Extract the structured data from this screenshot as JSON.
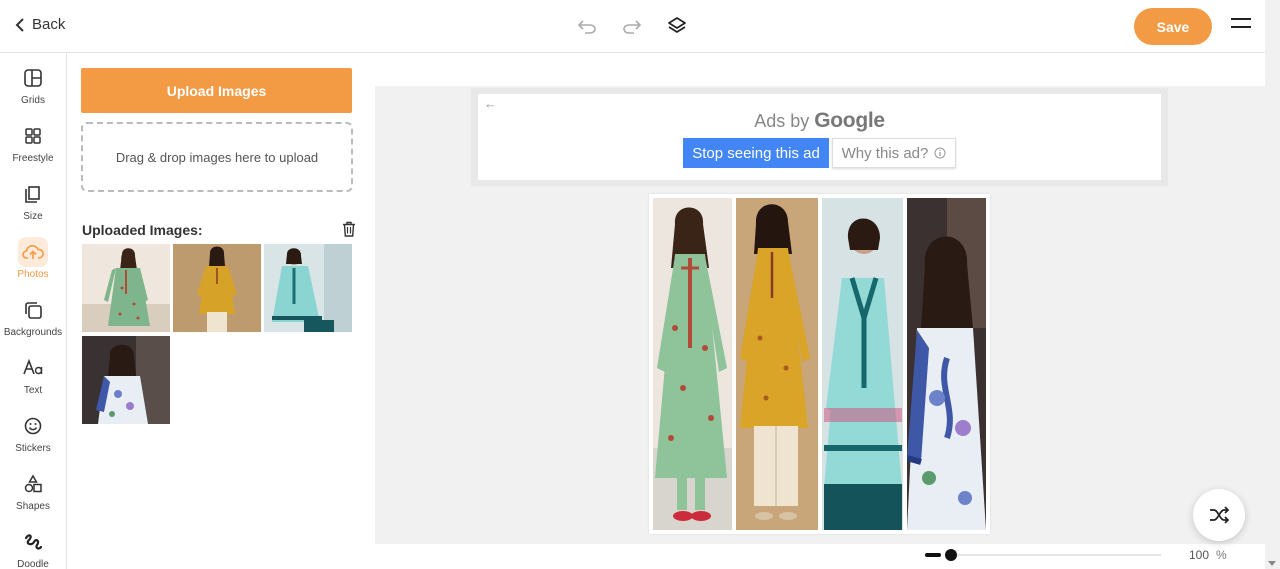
{
  "header": {
    "back_label": "Back",
    "save_label": "Save"
  },
  "rail": {
    "items": [
      {
        "label": "Grids",
        "icon": "grid-icon"
      },
      {
        "label": "Freestyle",
        "icon": "freestyle-icon"
      },
      {
        "label": "Size",
        "icon": "size-icon"
      },
      {
        "label": "Photos",
        "icon": "cloud-upload-icon",
        "active": true
      },
      {
        "label": "Backgrounds",
        "icon": "backgrounds-icon"
      },
      {
        "label": "Text",
        "icon": "text-icon"
      },
      {
        "label": "Stickers",
        "icon": "smiley-icon"
      },
      {
        "label": "Shapes",
        "icon": "shapes-icon"
      },
      {
        "label": "Doodle",
        "icon": "doodle-icon"
      }
    ]
  },
  "panel": {
    "upload_label": "Upload Images",
    "dropzone_text": "Drag & drop images here to upload",
    "uploaded_title": "Uploaded Images:"
  },
  "ad": {
    "ads_by": "Ads by",
    "brand": "Google",
    "stop_label": "Stop seeing this ad",
    "why_label": "Why this ad?"
  },
  "zoom": {
    "value": "100",
    "unit": "%"
  },
  "colors": {
    "accent": "#f39a45",
    "ad_blue": "#4285f4"
  }
}
